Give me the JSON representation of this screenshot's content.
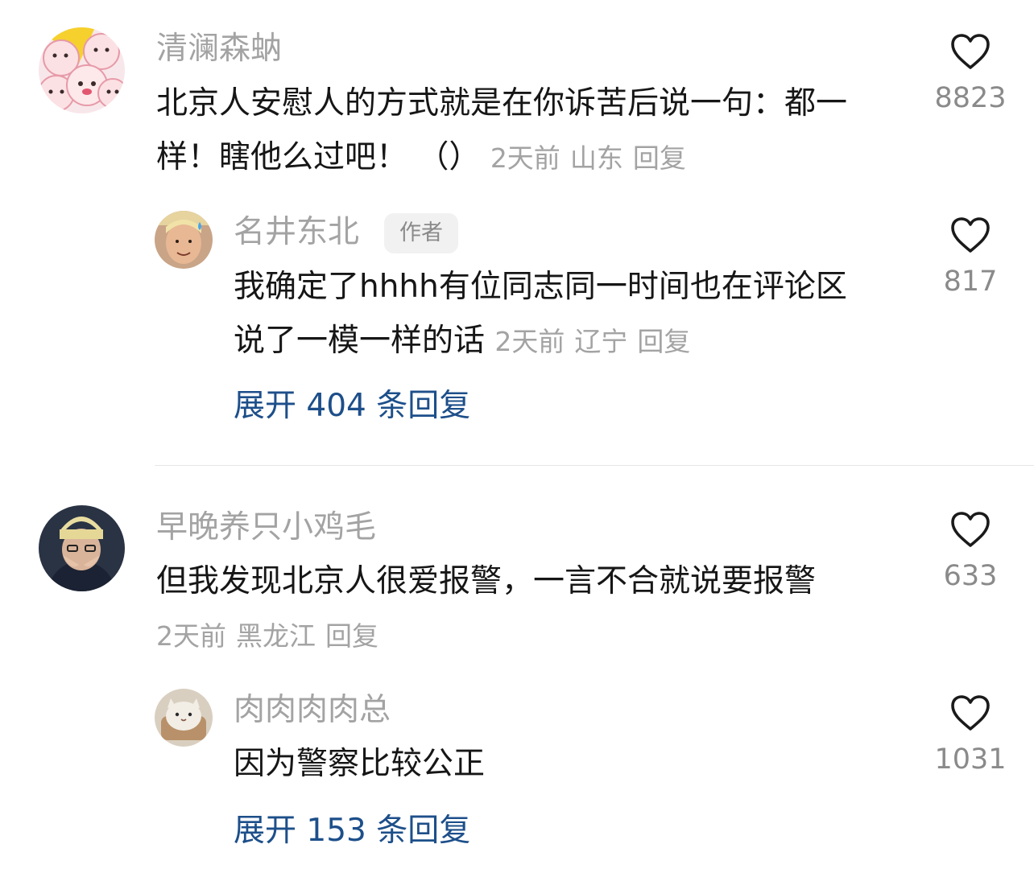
{
  "comments": [
    {
      "username": "清澜森蚋",
      "text": "北京人安慰人的方式就是在你诉苦后说一句：都一样！瞎他么过吧！ （）",
      "time": "2天前",
      "location": "山东",
      "reply_label": "回复",
      "likes": "8823",
      "avatar_icon": "cartoon-pig-avatar",
      "replies": [
        {
          "username": "名井东北",
          "badge": "作者",
          "text": "我确定了hhhh有位同志同一时间也在评论区说了一模一样的话",
          "time": "2天前",
          "location": "辽宁",
          "reply_label": "回复",
          "likes": "817",
          "avatar_icon": "person-photo-avatar"
        }
      ],
      "expand_label": "展开 404 条回复"
    },
    {
      "username": "早晚养只小鸡毛",
      "text": "但我发现北京人很爱报警，一言不合就说要报警",
      "time": "2天前",
      "location": "黑龙江",
      "reply_label": "回复",
      "likes": "633",
      "avatar_icon": "person-beanie-avatar",
      "replies": [
        {
          "username": "肉肉肉肉总",
          "text": "因为警察比较公正",
          "likes": "1031",
          "avatar_icon": "cat-avatar"
        }
      ],
      "expand_label": "展开 153 条回复"
    }
  ],
  "colors": {
    "username": "#a3a3a3",
    "body": "#161616",
    "link": "#1d4f8a",
    "like_count": "#8a8a8a"
  }
}
